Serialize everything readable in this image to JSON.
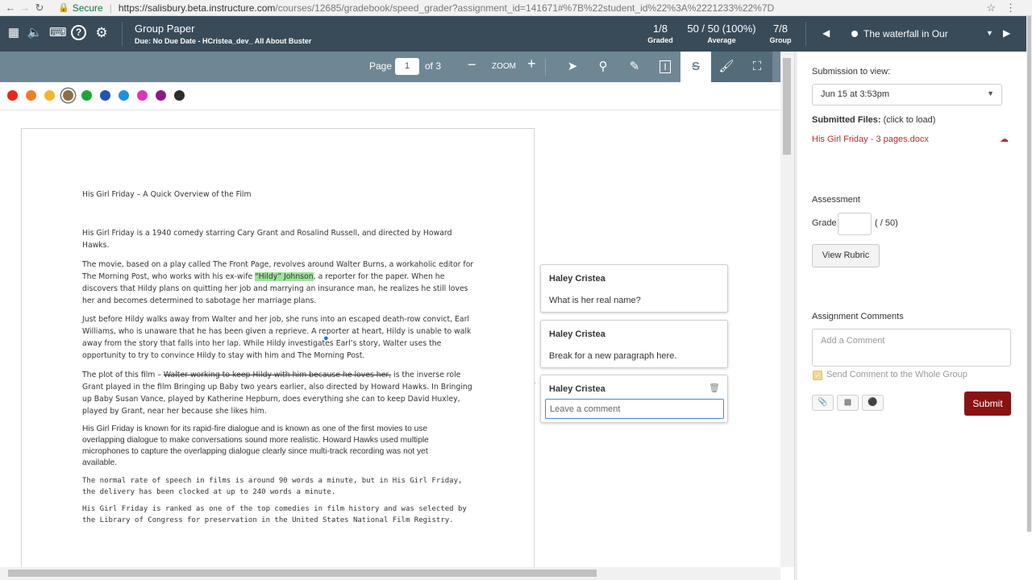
{
  "browser": {
    "secure_label": "Secure",
    "url_host": "https://salisbury.beta.instructure.com",
    "url_path": "/courses/12685/gradebook/speed_grader?assignment_id=141671#%7B%22student_id%22%3A%2221233%22%7D"
  },
  "header": {
    "assignment_title": "Group Paper",
    "assignment_subtitle": "Due: No Due Date - HCristea_dev_ All About Buster",
    "stats": [
      {
        "value": "1/8",
        "label": "Graded"
      },
      {
        "value": "50 / 50 (100%)",
        "label": "Average"
      },
      {
        "value": "7/8",
        "label": "Group"
      }
    ],
    "student_selector": "The waterfall in Our"
  },
  "annotation_toolbar": {
    "page_label": "Page",
    "page_value": "1",
    "of_label": "of 3",
    "zoom_label": "ZOOM"
  },
  "palette": {
    "colors": [
      "#e8261e",
      "#f07f23",
      "#f4b728",
      "#8d6e4b",
      "#1ea538",
      "#1f56b5",
      "#1e91de",
      "#d63bb5",
      "#8b1b82",
      "#2d2d2d"
    ],
    "selected_index": 3
  },
  "document": {
    "title": "His Girl Friday – A Quick Overview of the Film",
    "p1": "His Girl Friday is a 1940 comedy starring Cary Grant and Rosalind Russell, and directed by Howard Hawks.",
    "p2_a": "The movie, based on a play called The Front Page, revolves around Walter Burns, a workaholic editor for The Morning Post, who works with his ex-wife ",
    "p2_hl": "“Hildy” Johnson",
    "p2_b": ", a reporter for the paper. When he discovers that Hildy plans on quitting her job and marrying an insurance man, he realizes he still loves her and becomes determined to sabotage her marriage plans.",
    "p3": "Just before Hildy walks away from Walter and her job, she runs into an escaped death-row convict, Earl Williams, who is unaware that he has been given a reprieve. A reporter at heart, Hildy is unable to walk away from the story that falls into her lap. While Hildy investigates Earl’s story, Walter uses the opportunity to try to convince Hildy to stay with him and The Morning Post.",
    "p4_a": "The plot of this film – ",
    "p4_strike": "Walter working to keep Hildy with him because he loves her,",
    "p4_b": " is the inverse role Grant played in the film Bringing up Baby two years earlier, also directed by Howard Hawks. In Bringing up Baby Susan Vance, played by Katherine Hepburn, does everything she can to keep David Huxley, played by Grant, near her because she likes him.",
    "p5": "His Girl Friday is known for its rapid-fire dialogue and is known as one of the first movies to use overlapping dialogue to make conversations sound more realistic. Howard Hawks used multiple microphones to capture the overlapping dialogue clearly since multi-track recording was not yet available.",
    "p6": "The normal rate of speech in films is around 90 words a minute, but in His Girl Friday, the delivery has been clocked at up to 240 words a minute.",
    "p7": "His Girl Friday is ranked as one of the top comedies in film history and was selected by the Library of Congress for preservation in the United States National Film Registry."
  },
  "comments": [
    {
      "author": "Haley Cristea",
      "text": "What is her real name?"
    },
    {
      "author": "Haley Cristea",
      "text": "Break for a new paragraph here."
    },
    {
      "author": "Haley Cristea",
      "placeholder": "Leave a comment"
    }
  ],
  "right_panel": {
    "submission_label": "Submission to view:",
    "submission_value": "Jun 15 at 3:53pm",
    "submitted_files_label": "Submitted Files:",
    "submitted_files_hint": "(click to load)",
    "file_name": "His Girl Friday - 3 pages.docx",
    "assessment_label": "Assessment",
    "grade_label": "Grade",
    "grade_out_of": "( / 50)",
    "view_rubric": "View Rubric",
    "assignment_comments_label": "Assignment Comments",
    "comment_placeholder": "Add a Comment",
    "send_group_label": "Send Comment to the Whole Group",
    "submit_label": "Submit"
  }
}
